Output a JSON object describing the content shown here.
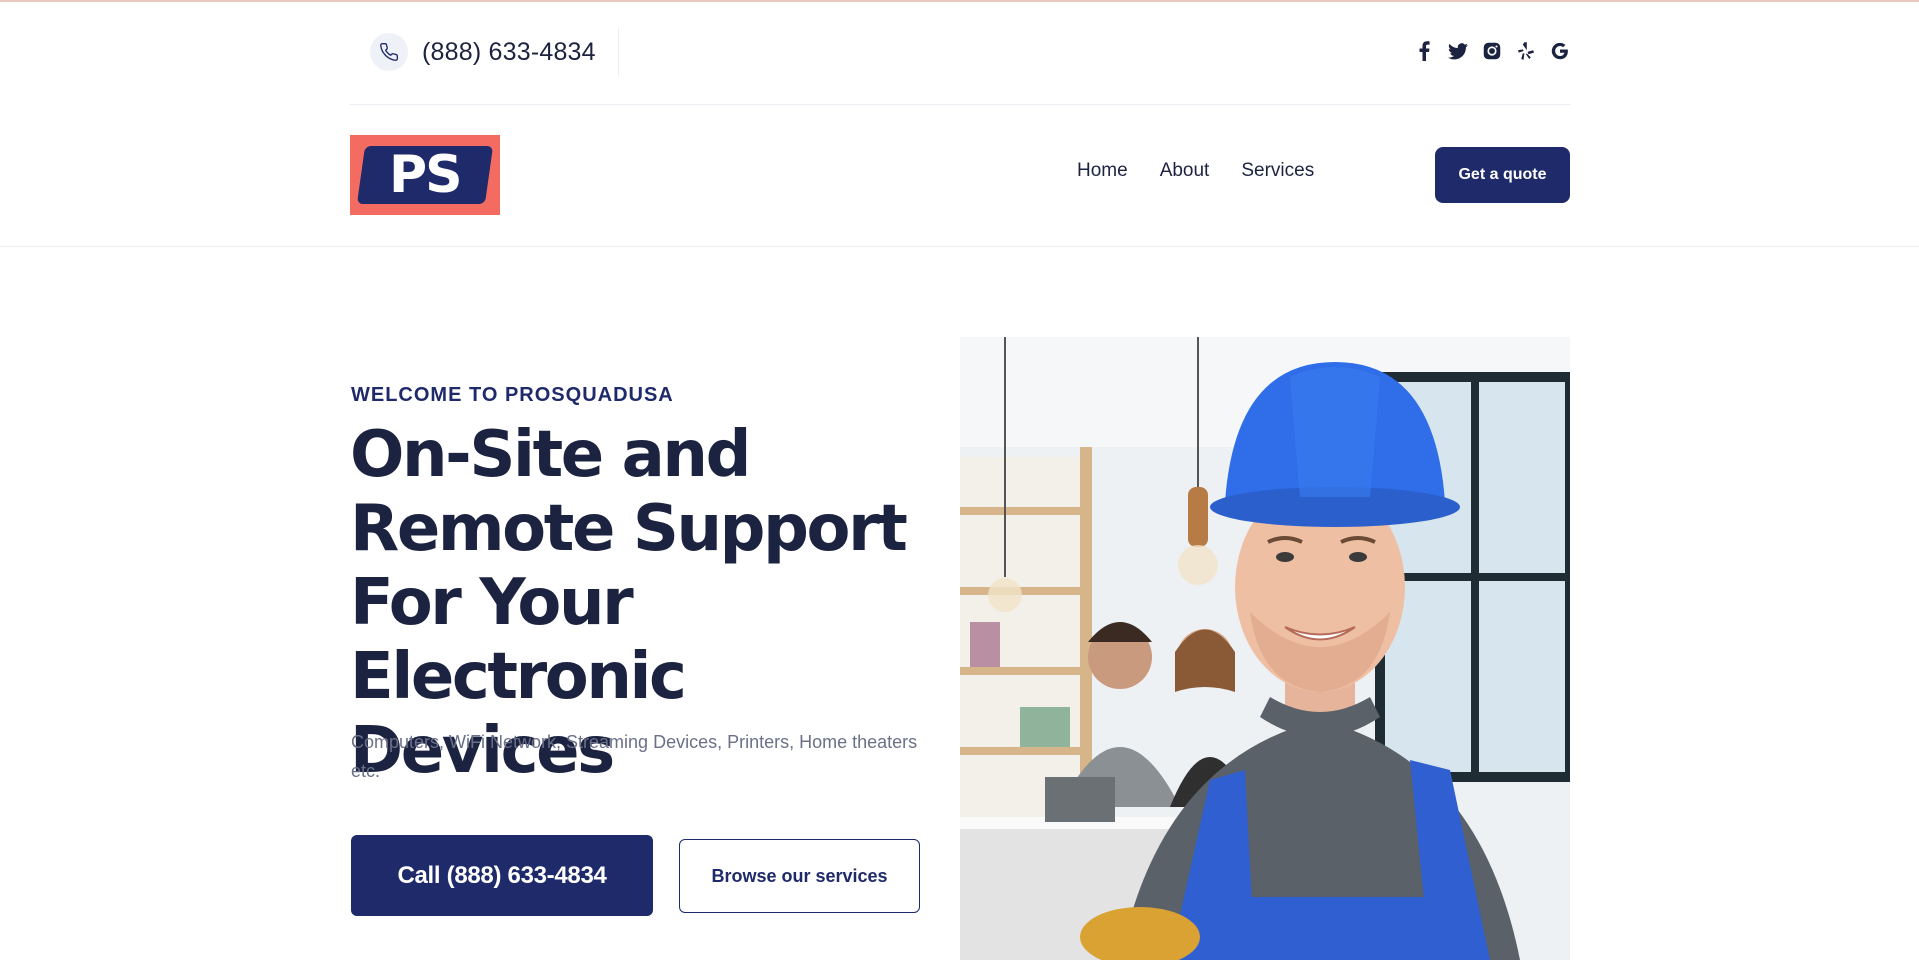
{
  "topbar": {
    "phone": "(888) 633-4834",
    "socials": [
      {
        "icon": "facebook-icon",
        "glyph": "f"
      },
      {
        "icon": "twitter-icon",
        "glyph": ""
      },
      {
        "icon": "instagram-icon",
        "glyph": ""
      },
      {
        "icon": "yelp-icon",
        "glyph": ""
      },
      {
        "icon": "google-icon",
        "glyph": "G"
      }
    ]
  },
  "header": {
    "logo_text": "PS",
    "nav": [
      "Home",
      "About",
      "Services"
    ],
    "quote_button": "Get a quote"
  },
  "hero": {
    "eyebrow": "WELCOME TO PROSQUADUSA",
    "headline": "On-Site and Remote Support For Your Electronic Devices",
    "subtext": "Computers, WiFi Network, Streaming Devices, Printers, Home theaters etc.",
    "call_button": "Call (888) 633-4834",
    "browse_button": "Browse our services"
  },
  "colors": {
    "brand_navy": "#1f2a6b",
    "logo_coral": "#f46b62",
    "text_dark": "#1c2340",
    "text_muted": "#6a7088"
  }
}
